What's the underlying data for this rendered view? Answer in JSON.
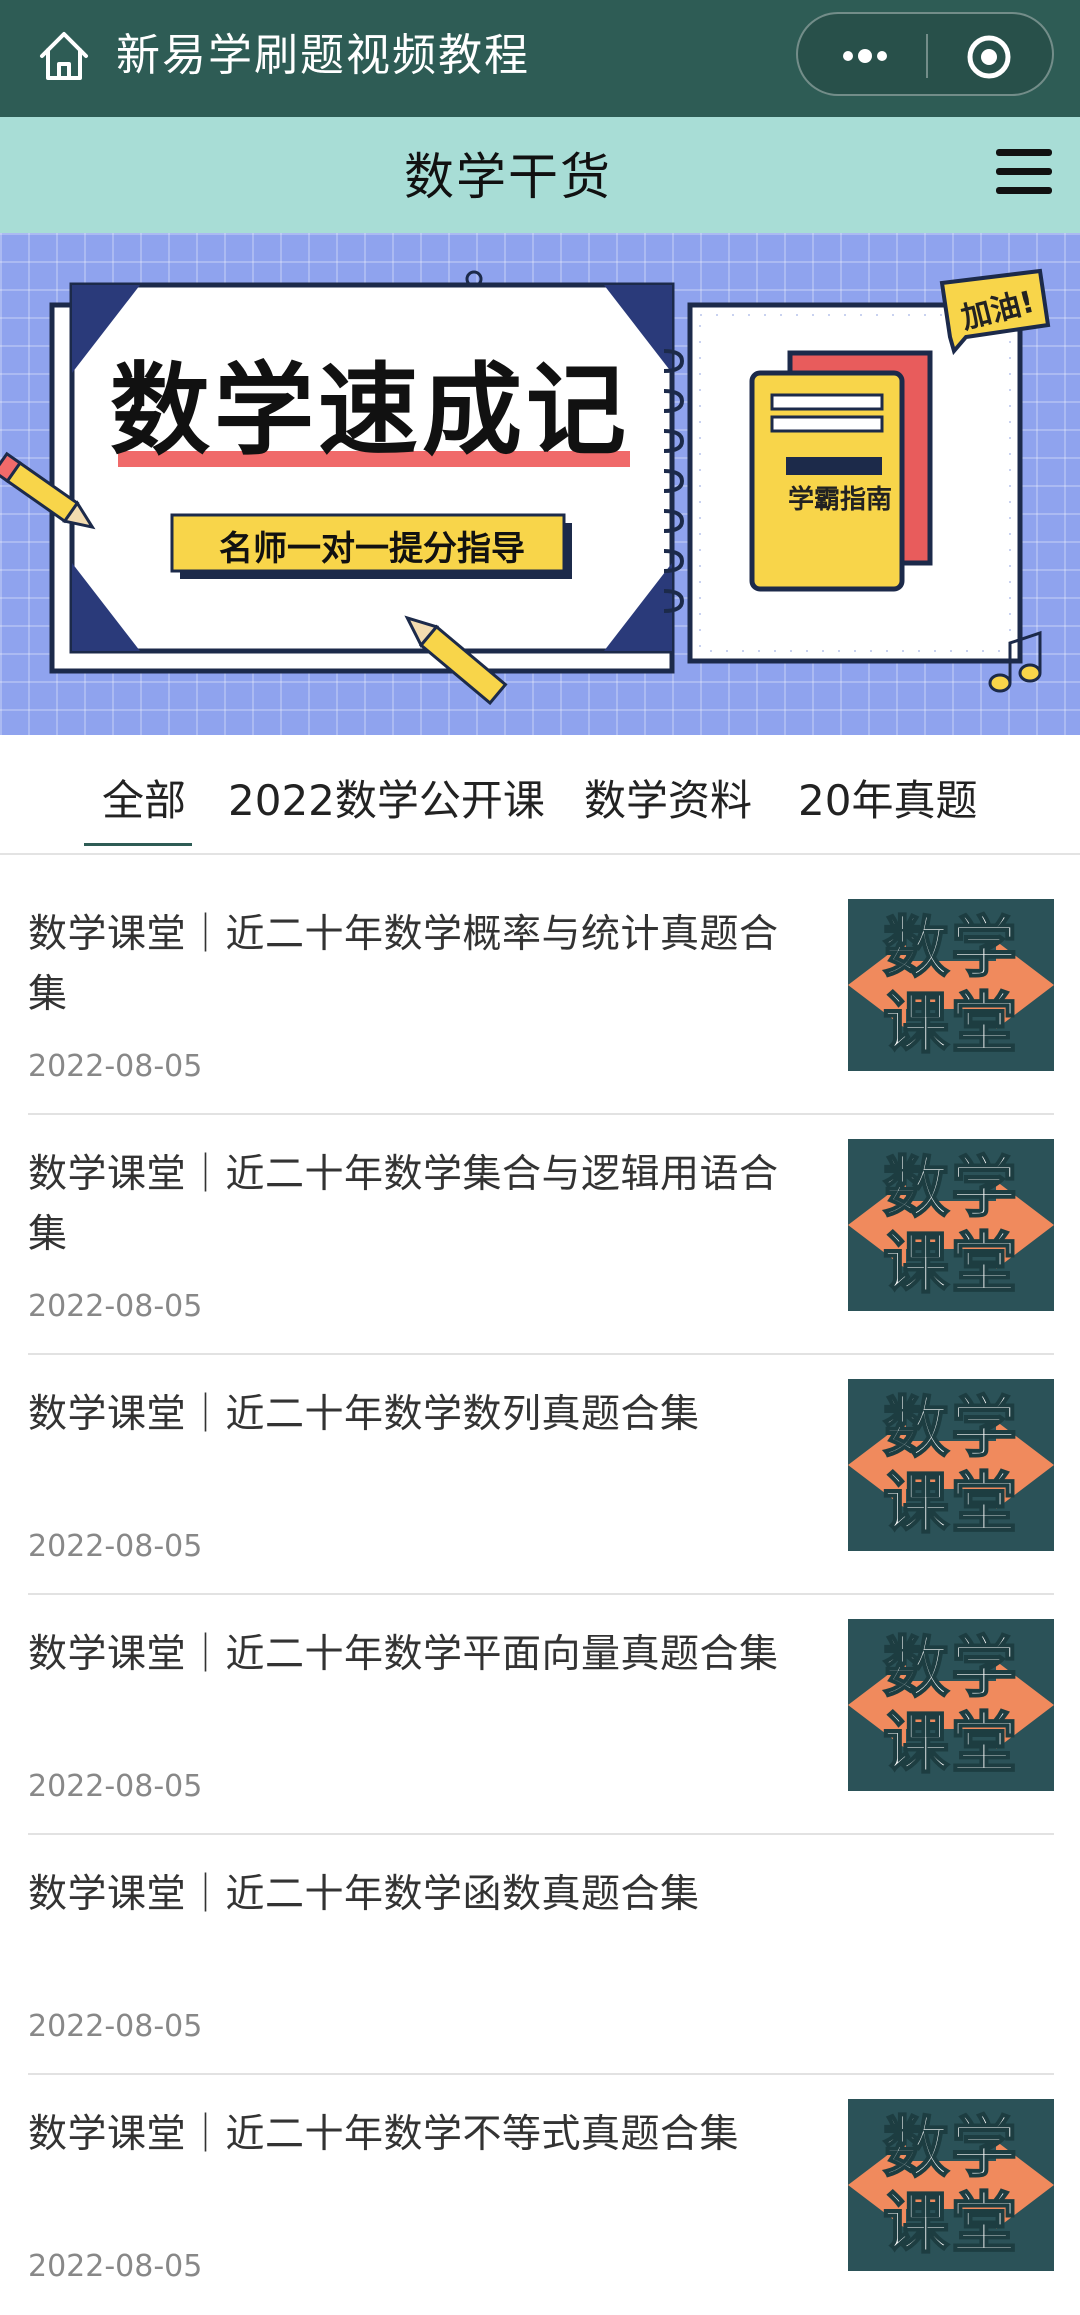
{
  "topbar": {
    "title": "新易学刷题视频教程",
    "icons": {
      "home": "home-icon",
      "more": "more-dots-icon",
      "close": "circle-target-icon"
    }
  },
  "subbar": {
    "title": "数学干货",
    "menu_icon": "hamburger-menu-icon"
  },
  "banner": {
    "title": "数学速成记",
    "subtitle": "名师一对一提分指导",
    "book_label": "学霸指南",
    "sticker": "加油!"
  },
  "tabs": [
    {
      "label": "全部",
      "active": true
    },
    {
      "label": "2022数学公开课",
      "active": false
    },
    {
      "label": "数学资料",
      "active": false
    },
    {
      "label": "20年真题",
      "active": false
    }
  ],
  "articles": [
    {
      "title": "数学课堂｜近二十年数学概率与统计真题合集",
      "date": "2022-08-05",
      "thumb": [
        "数学",
        "课堂"
      ],
      "has_thumb": true
    },
    {
      "title": "数学课堂｜近二十年数学集合与逻辑用语合集",
      "date": "2022-08-05",
      "thumb": [
        "数学",
        "课堂"
      ],
      "has_thumb": true
    },
    {
      "title": "数学课堂｜近二十年数学数列真题合集",
      "date": "2022-08-05",
      "thumb": [
        "数学",
        "课堂"
      ],
      "has_thumb": true
    },
    {
      "title": "数学课堂｜近二十年数学平面向量真题合集",
      "date": "2022-08-05",
      "thumb": [
        "数学",
        "课堂"
      ],
      "has_thumb": true
    },
    {
      "title": "数学课堂｜近二十年数学函数真题合集",
      "date": "2022-08-05",
      "thumb": [],
      "has_thumb": false
    },
    {
      "title": "数学课堂｜近二十年数学不等式真题合集",
      "date": "2022-08-05",
      "thumb": [
        "数学",
        "课堂"
      ],
      "has_thumb": true
    }
  ],
  "colors": {
    "topbar": "#2e5c55",
    "subbar": "#a8ddd6",
    "banner_bg": "#8fa3ee",
    "thumb_bg": "#2b5258",
    "thumb_arrow": "#f08a5d"
  }
}
